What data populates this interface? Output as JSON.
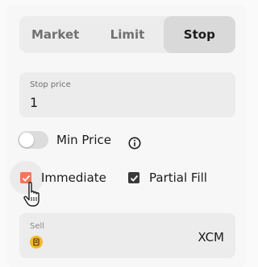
{
  "order_types": {
    "tabs": [
      {
        "label": "Market"
      },
      {
        "label": "Limit"
      },
      {
        "label": "Stop"
      }
    ],
    "active": "Stop"
  },
  "stop_price": {
    "label": "Stop price",
    "value": "1"
  },
  "min_price": {
    "label": "Min Price",
    "enabled": false,
    "info_icon": "info-icon"
  },
  "options": {
    "immediate": {
      "label": "Immediate",
      "checked": true,
      "color": "#f2765a"
    },
    "partial_fill": {
      "label": "Partial Fill",
      "checked": true,
      "color": "#3a3a3a"
    }
  },
  "sell": {
    "label": "Sell",
    "currency": "XCM",
    "coin_icon": "coin-icon",
    "coin_color": "#f5b82e"
  }
}
